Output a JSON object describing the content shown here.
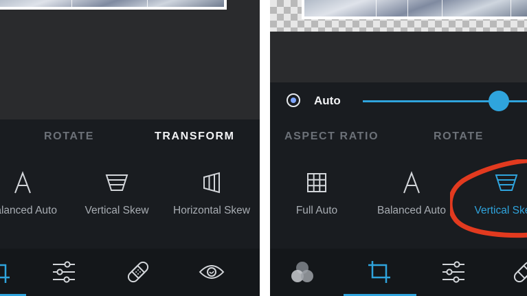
{
  "left": {
    "tabs": [
      "ROTATE",
      "TRANSFORM"
    ],
    "active_tab": "TRANSFORM",
    "tools": [
      {
        "label": "Balanced Auto",
        "icon": "letter-a-icon"
      },
      {
        "label": "Vertical Skew",
        "icon": "vertical-skew-icon"
      },
      {
        "label": "Horizontal Skew",
        "icon": "horizontal-skew-icon"
      }
    ],
    "bottom_icons": [
      "crop-icon",
      "sliders-icon",
      "bandage-icon",
      "eye-icon"
    ],
    "active_bottom": "crop-icon"
  },
  "right": {
    "auto_label": "Auto",
    "auto_slider_value": 0.8,
    "tabs": [
      "ASPECT RATIO",
      "ROTATE"
    ],
    "tools": [
      {
        "label": "Full Auto",
        "icon": "grid-icon"
      },
      {
        "label": "Balanced Auto",
        "icon": "letter-a-icon"
      },
      {
        "label": "Vertical Skew",
        "icon": "vertical-skew-icon"
      }
    ],
    "active_tool": "Vertical Skew",
    "bottom_icons": [
      "circles-icon",
      "crop-icon",
      "sliders-icon",
      "bandage-icon"
    ],
    "active_bottom": "crop-icon"
  },
  "colors": {
    "accent": "#2fa4dd",
    "annotation": "#e23a1f",
    "panel_bg": "#191c20",
    "bar_bg": "#14171a"
  }
}
